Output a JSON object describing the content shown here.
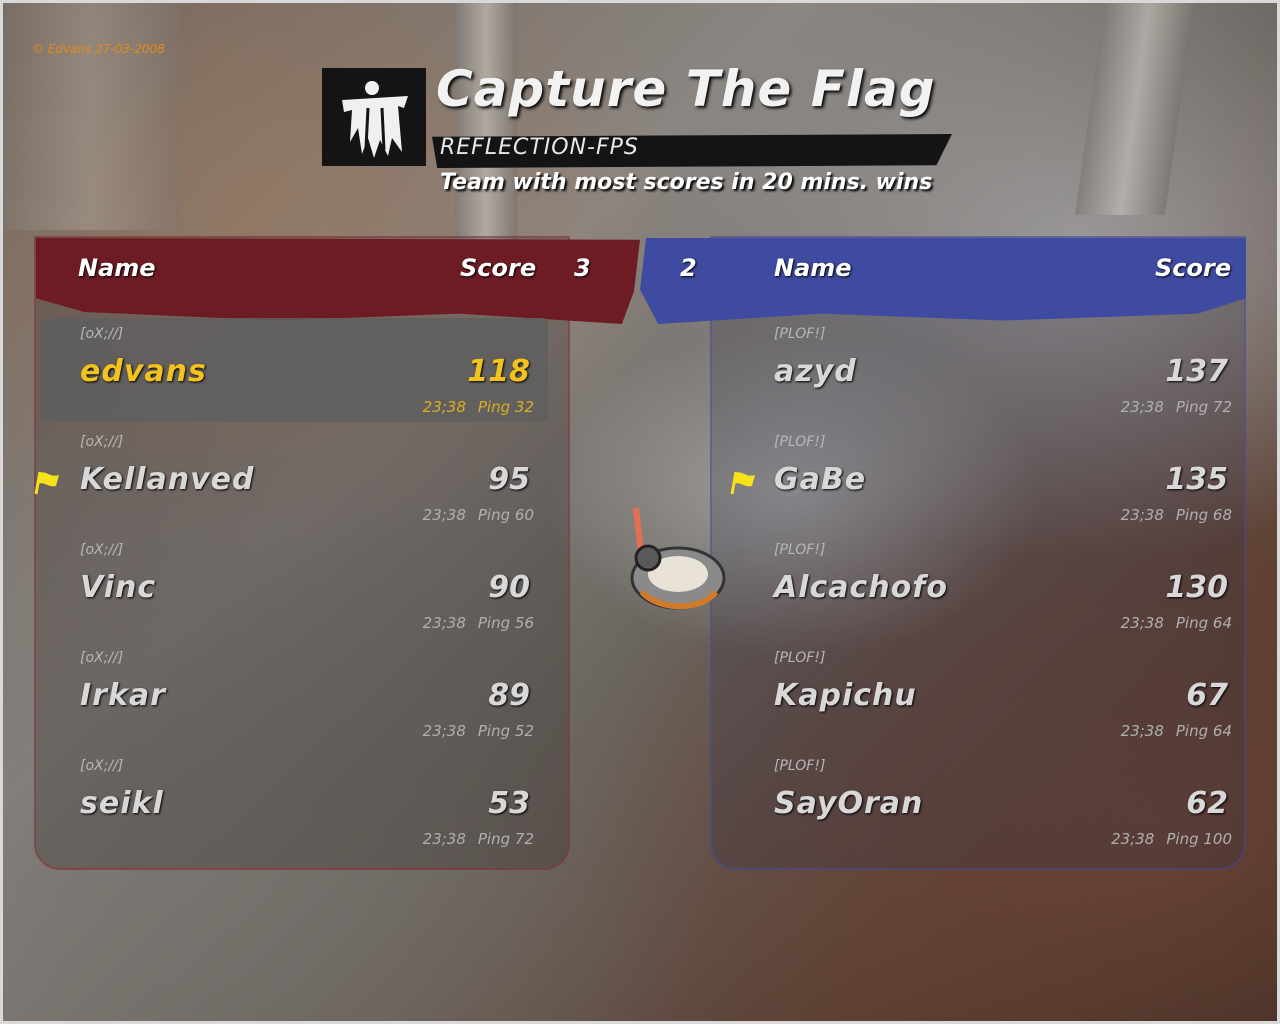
{
  "copyright": "© Edvans 27-03-2008",
  "header": {
    "title": "Capture The Flag",
    "map": "REFLECTION-FPS",
    "objective": "Team with most scores in 20 mins. wins",
    "logo_icon": "flag-emblem-icon"
  },
  "red_team": {
    "color": "#6e1c24",
    "name_col": "Name",
    "score_col": "Score",
    "team_score": "3",
    "players": [
      {
        "clan": "[oX;//]",
        "name": "edvans",
        "score": "118",
        "time": "23;38",
        "ping": "Ping 32",
        "highlight": true,
        "flag": false
      },
      {
        "clan": "[oX;//]",
        "name": "Kellanved",
        "score": "95",
        "time": "23;38",
        "ping": "Ping 60",
        "highlight": false,
        "flag": true
      },
      {
        "clan": "[oX;//]",
        "name": "Vinc",
        "score": "90",
        "time": "23;38",
        "ping": "Ping 56",
        "highlight": false,
        "flag": false
      },
      {
        "clan": "[oX;//]",
        "name": "Irkar",
        "score": "89",
        "time": "23;38",
        "ping": "Ping 52",
        "highlight": false,
        "flag": false
      },
      {
        "clan": "[oX;//]",
        "name": "seikl",
        "score": "53",
        "time": "23;38",
        "ping": "Ping 72",
        "highlight": false,
        "flag": false
      }
    ]
  },
  "blue_team": {
    "color": "#3f4ba0",
    "name_col": "Name",
    "score_col": "Score",
    "team_score": "2",
    "players": [
      {
        "clan": "[PLOF!]",
        "name": "azyd",
        "score": "137",
        "time": "23;38",
        "ping": "Ping 72",
        "flag": false
      },
      {
        "clan": "[PLOF!]",
        "name": "GaBe",
        "score": "135",
        "time": "23;38",
        "ping": "Ping 68",
        "flag": true
      },
      {
        "clan": "[PLOF!]",
        "name": "Alcachofo",
        "score": "130",
        "time": "23;38",
        "ping": "Ping 64",
        "flag": false
      },
      {
        "clan": "[PLOF!]",
        "name": "Kapichu",
        "score": "67",
        "time": "23;38",
        "ping": "Ping 64",
        "flag": false
      },
      {
        "clan": "[PLOF!]",
        "name": "SayOran",
        "score": "62",
        "time": "23;38",
        "ping": "Ping 100",
        "flag": false
      }
    ]
  },
  "colors": {
    "highlight_name": "#f3c21d",
    "flag_icon": "#f5e21a"
  }
}
